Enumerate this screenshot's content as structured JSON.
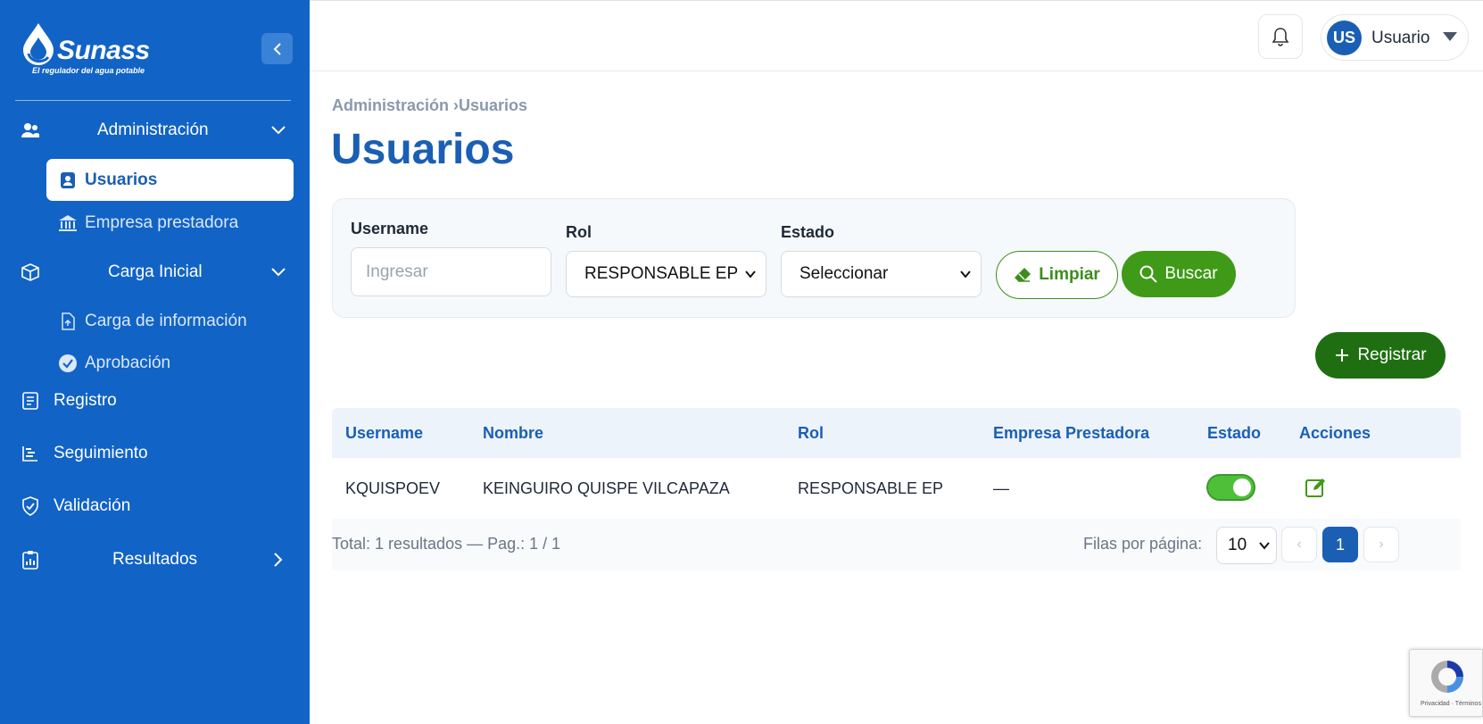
{
  "brand": {
    "name": "Sunass",
    "tagline": "El regulador del agua potable"
  },
  "sidebar": {
    "groups": [
      {
        "label": "Administración",
        "icon": "users-icon",
        "expanded": true,
        "items": [
          {
            "label": "Usuarios",
            "icon": "user-badge-icon",
            "active": true
          },
          {
            "label": "Empresa prestadora",
            "icon": "bank-icon",
            "active": false
          }
        ]
      },
      {
        "label": "Carga Inicial",
        "icon": "box-icon",
        "expanded": true,
        "items": [
          {
            "label": "Carga de información",
            "icon": "file-upload-icon",
            "active": false
          },
          {
            "label": "Aprobación",
            "icon": "verified-badge-icon",
            "active": false
          }
        ]
      },
      {
        "label": "Registro",
        "icon": "form-list-icon"
      },
      {
        "label": "Seguimiento",
        "icon": "tasks-icon"
      },
      {
        "label": "Validación",
        "icon": "shield-check-icon"
      },
      {
        "label": "Resultados",
        "icon": "clipboard-chart-icon",
        "expanded": false
      }
    ]
  },
  "header": {
    "user": {
      "initials": "US",
      "name": "Usuario"
    }
  },
  "main": {
    "breadcrumb": "Administración ›Usuarios",
    "title": "Usuarios",
    "filters": {
      "username_label": "Username",
      "username_placeholder": "Ingresar",
      "rol_label": "Rol",
      "rol_value": "RESPONSABLE EP",
      "estado_label": "Estado",
      "estado_value": "Seleccionar",
      "clear_label": "Limpiar",
      "search_label": "Buscar"
    },
    "register_label": "Registrar",
    "table": {
      "columns": [
        "Username",
        "Nombre",
        "Rol",
        "Empresa Prestadora",
        "Estado",
        "Acciones"
      ],
      "rows": [
        {
          "username": "KQUISPOEV",
          "nombre": "KEINGUIRO QUISPE VILCAPAZA",
          "rol": "RESPONSABLE EP",
          "empresa": "—",
          "estado_active": true
        }
      ]
    },
    "pagination": {
      "total_text": "Total: 1 resultados — Pag.: 1 / 1",
      "rows_per_page_label": "Filas por página:",
      "rows_per_page": "10",
      "prev": "‹",
      "current_page": "1",
      "next": "›"
    }
  },
  "recaptcha": {
    "text": "Privacidad · Términos"
  },
  "colors": {
    "sidebar": "#1163c6",
    "primary": "#1a5fb4",
    "success": "#3f9a17",
    "register": "#1f6f12"
  }
}
